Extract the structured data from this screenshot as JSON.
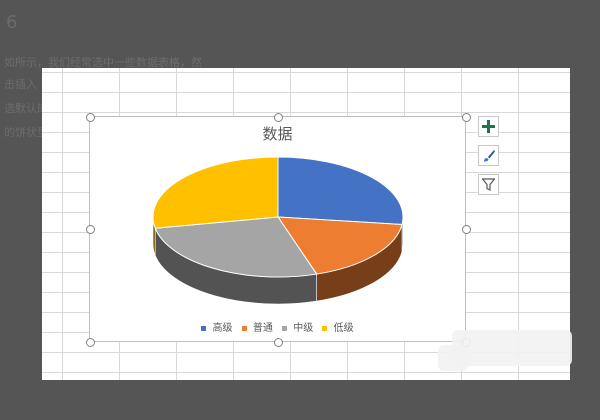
{
  "document": {
    "heading": "6",
    "lines": [
      "如所示，我们经常选中一些数据表格，然",
      "击插入",
      "选默认的",
      "的饼状型"
    ]
  },
  "chart_toolbar": {
    "add_element_icon": "plus-icon",
    "style_icon": "paintbrush-icon",
    "filter_icon": "filter-icon"
  },
  "colors": {
    "高级": "#4472C4",
    "普通": "#ED7D31",
    "中级": "#A5A5A5",
    "低级": "#FFC000"
  },
  "chart_data": {
    "type": "pie",
    "title": "数据",
    "style": "3d",
    "legend_position": "bottom",
    "categories": [
      "高级",
      "普通",
      "中级",
      "低级"
    ],
    "values": [
      27,
      18,
      27,
      28
    ]
  }
}
